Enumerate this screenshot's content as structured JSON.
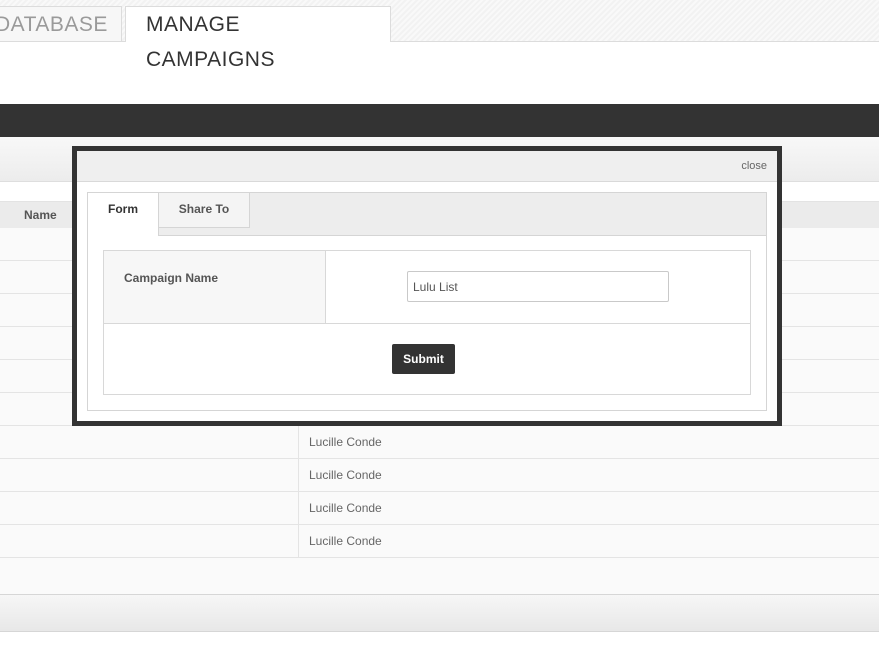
{
  "top_tabs": [
    {
      "label": "DATABASE"
    },
    {
      "label": "MANAGE CAMPAIGNS"
    }
  ],
  "table": {
    "header_name": "Name",
    "rows": [
      {
        "owner": ""
      },
      {
        "owner": ""
      },
      {
        "owner": ""
      },
      {
        "owner": ""
      },
      {
        "owner": ""
      },
      {
        "owner": ""
      },
      {
        "owner": "Lucille Conde"
      },
      {
        "owner": "Lucille Conde"
      },
      {
        "owner": "Lucille Conde"
      },
      {
        "owner": "Lucille Conde"
      }
    ]
  },
  "modal": {
    "close_label": "close",
    "tabs": [
      {
        "label": "Form"
      },
      {
        "label": "Share To"
      }
    ],
    "form": {
      "campaign_name_label": "Campaign Name",
      "campaign_name_value": "Lulu List",
      "submit_label": "Submit"
    }
  },
  "colors": {
    "dark_bar": "#333333",
    "modal_border": "#333333",
    "submit_bg": "#333333"
  }
}
